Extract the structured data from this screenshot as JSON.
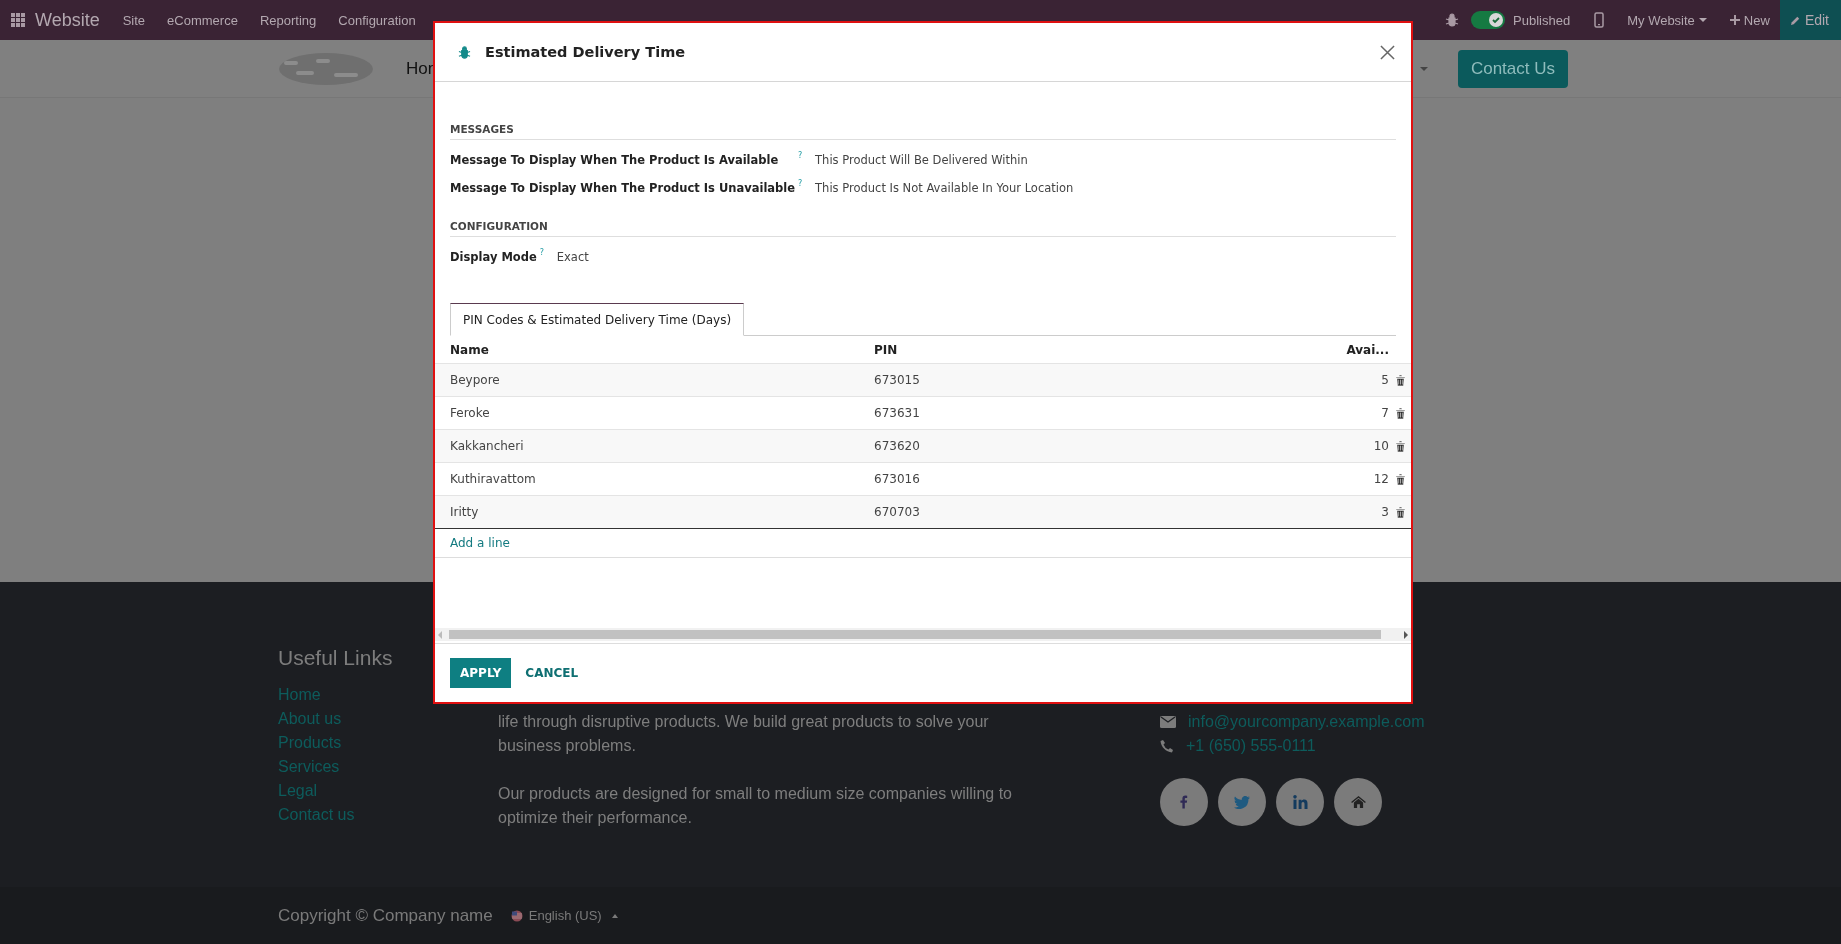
{
  "top_bar": {
    "app_name": "Website",
    "menu": [
      "Site",
      "eCommerce",
      "Reporting",
      "Configuration"
    ],
    "published": {
      "label": "Published",
      "on": true
    },
    "website_switcher": "My Website",
    "new_button": "New",
    "edit_button": "Edit"
  },
  "site_header": {
    "nav_partial": "Hon",
    "contact_button": "Contact Us"
  },
  "dialog": {
    "title": "Estimated Delivery Time",
    "sections": [
      {
        "heading": "MESSAGES",
        "fields": [
          {
            "label": "Message To Display When The Product Is Available",
            "help": "?",
            "value": "This Product Will Be Delivered Within"
          },
          {
            "label": "Message To Display When The Product Is Unavailable",
            "help": "?",
            "value": "This Product Is Not Available In Your Location"
          }
        ]
      },
      {
        "heading": "CONFIGURATION",
        "fields": [
          {
            "label": "Display Mode",
            "help": "?",
            "value": "Exact"
          }
        ]
      }
    ],
    "tabs": [
      {
        "label": "PIN Codes & Estimated Delivery Time (Days)",
        "selected": true
      }
    ],
    "table": {
      "columns": [
        "Name",
        "PIN",
        "Avai..."
      ],
      "rows": [
        {
          "cells": [
            "Beypore",
            "673015",
            "5"
          ]
        },
        {
          "cells": [
            "Feroke",
            "673631",
            "7"
          ]
        },
        {
          "cells": [
            "Kakkancheri",
            "673620",
            "10"
          ]
        },
        {
          "cells": [
            "Kuthiravattom",
            "673016",
            "12"
          ]
        },
        {
          "cells": [
            "Iritty",
            "670703",
            "3"
          ]
        }
      ]
    },
    "add_line": "Add a line",
    "buttons": [
      {
        "label": "APPLY",
        "kind": "primary"
      },
      {
        "label": "CANCEL",
        "kind": "secondary"
      }
    ]
  },
  "footer": {
    "links_title": "Useful Links",
    "links": [
      "Home",
      "About us",
      "Products",
      "Services",
      "Legal",
      "Contact us"
    ],
    "about_paragraphs": [
      "life through disruptive products. We build great products to solve your business problems.",
      "Our products are designed for small to medium size companies willing to optimize their performance."
    ],
    "contacts": [
      {
        "kind": "email",
        "text": "info@yourcompany.example.com"
      },
      {
        "kind": "phone",
        "text": "+1 (650) 555-0111"
      }
    ],
    "copyright": "Copyright © Company name",
    "language": "English (US)"
  }
}
